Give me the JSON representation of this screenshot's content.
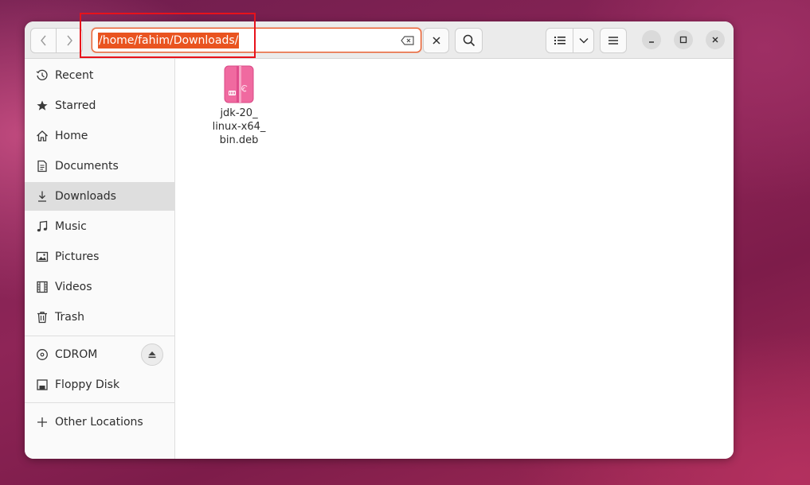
{
  "location_bar": {
    "path": "/home/fahim/Downloads/"
  },
  "sidebar": {
    "items": [
      {
        "label": "Recent",
        "icon": "clock-icon"
      },
      {
        "label": "Starred",
        "icon": "star-icon"
      },
      {
        "label": "Home",
        "icon": "home-icon"
      },
      {
        "label": "Documents",
        "icon": "document-icon"
      },
      {
        "label": "Downloads",
        "icon": "download-icon",
        "active": true
      },
      {
        "label": "Music",
        "icon": "music-note-icon"
      },
      {
        "label": "Pictures",
        "icon": "picture-icon"
      },
      {
        "label": "Videos",
        "icon": "film-icon"
      },
      {
        "label": "Trash",
        "icon": "trash-icon"
      }
    ],
    "devices": [
      {
        "label": "CDROM",
        "icon": "disc-icon",
        "eject": true
      },
      {
        "label": "Floppy Disk",
        "icon": "floppy-icon"
      }
    ],
    "other": {
      "label": "Other Locations",
      "icon": "plus-icon"
    }
  },
  "files": [
    {
      "name_lines": [
        "jdk-20_",
        "linux-x64_",
        "bin.deb"
      ],
      "icon": "deb-package-icon"
    }
  ],
  "colors": {
    "accent": "#e95420",
    "annotation_box": "#e8121b",
    "package_pink": "#f06aa0"
  }
}
